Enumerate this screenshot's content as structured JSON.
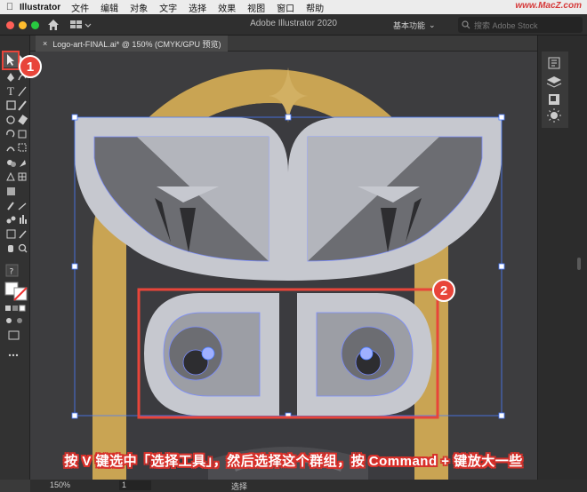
{
  "menubar": {
    "app_name": "Illustrator",
    "items": [
      "文件",
      "编辑",
      "对象",
      "文字",
      "选择",
      "效果",
      "视图",
      "窗口",
      "帮助"
    ],
    "watermark": "www.MacZ.com"
  },
  "appbar": {
    "title": "Adobe Illustrator 2020",
    "workspace": "基本功能",
    "search_placeholder": "搜索 Adobe Stock"
  },
  "document_tab": {
    "label": "Logo-art-FINAL.ai* @ 150% (CMYK/GPU 预览)",
    "close": "×"
  },
  "statusbar": {
    "zoom": "150%",
    "page": "1",
    "tool": "选择"
  },
  "annotations": {
    "badge_1": "1",
    "badge_2": "2",
    "caption": "按 V 键选中「选择工具」，然后选择这个群组，按 Command + 键放大一些"
  },
  "colors": {
    "accent_red": "#e8453a",
    "artboard_bg": "#3d3d3f",
    "gold": "#c9a453",
    "wing_light": "#c6c8cf",
    "wing_dark": "#6c6d72",
    "selection_blue": "#4a7bff"
  }
}
